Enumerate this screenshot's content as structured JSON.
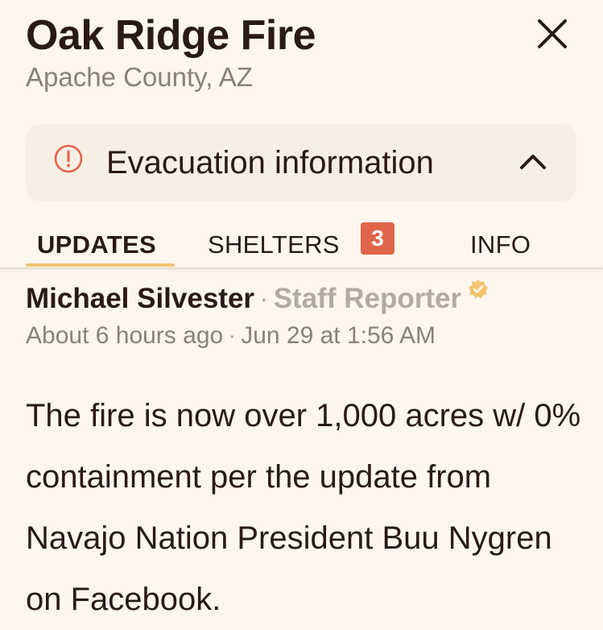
{
  "header": {
    "title": "Oak Ridge Fire",
    "subtitle": "Apache County, AZ"
  },
  "evacuation": {
    "label": "Evacuation information",
    "expanded": true
  },
  "tabs": [
    {
      "label": "UPDATES",
      "active": true
    },
    {
      "label": "SHELTERS",
      "badge": "3"
    },
    {
      "label": "INFO"
    }
  ],
  "post": {
    "author": "Michael Silvester",
    "separator": "·",
    "role": "Staff Reporter",
    "relative_time": "About 6 hours ago",
    "date": "Jun 29 at 1:56 AM",
    "body": "The fire is now over 1,000 acres w/ 0% containment per the update from Navajo Nation President Buu Nygren on Facebook."
  },
  "colors": {
    "background": "#fdf6ec",
    "accent_underline": "#f2c46f",
    "badge": "#e0644a",
    "alert": "#e0644a",
    "verified": "#f2c46f"
  },
  "icons": {
    "close": "close-icon",
    "alert": "alert-circle-icon",
    "collapse": "chevron-up-icon",
    "verified": "verified-badge-icon"
  }
}
